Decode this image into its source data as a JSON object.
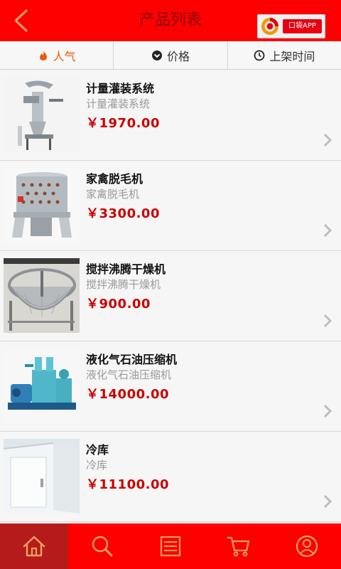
{
  "header": {
    "title": "产品列表",
    "badge_text": "口袋APP"
  },
  "filters": [
    {
      "label": "人气",
      "icon": "flame-icon",
      "active": true
    },
    {
      "label": "价格",
      "icon": "chevron-circle-down-icon",
      "active": false
    },
    {
      "label": "上架时间",
      "icon": "clock-icon",
      "active": false
    }
  ],
  "products": [
    {
      "name": "计量灌装系统",
      "subtitle": "计量灌装系统",
      "price": "￥1970.00"
    },
    {
      "name": "家禽脱毛机",
      "subtitle": "家禽脱毛机",
      "price": "￥3300.00"
    },
    {
      "name": "搅拌沸腾干燥机",
      "subtitle": "搅拌沸腾干燥机",
      "price": "￥900.00"
    },
    {
      "name": "液化气石油压缩机",
      "subtitle": "液化气石油压缩机",
      "price": "￥14000.00"
    },
    {
      "name": "冷库",
      "subtitle": "冷库",
      "price": "￥11100.00"
    }
  ],
  "bottom_nav": [
    {
      "icon": "home-icon",
      "active": true
    },
    {
      "icon": "search-icon",
      "active": false
    },
    {
      "icon": "list-icon",
      "active": false
    },
    {
      "icon": "cart-icon",
      "active": false
    },
    {
      "icon": "user-icon",
      "active": false
    }
  ],
  "colors": {
    "header_red": "#ff0000",
    "title_text": "#8b0000",
    "price_red": "#cc0000",
    "active_filter": "#e85c0d",
    "nav_active": "#b51b1b"
  }
}
